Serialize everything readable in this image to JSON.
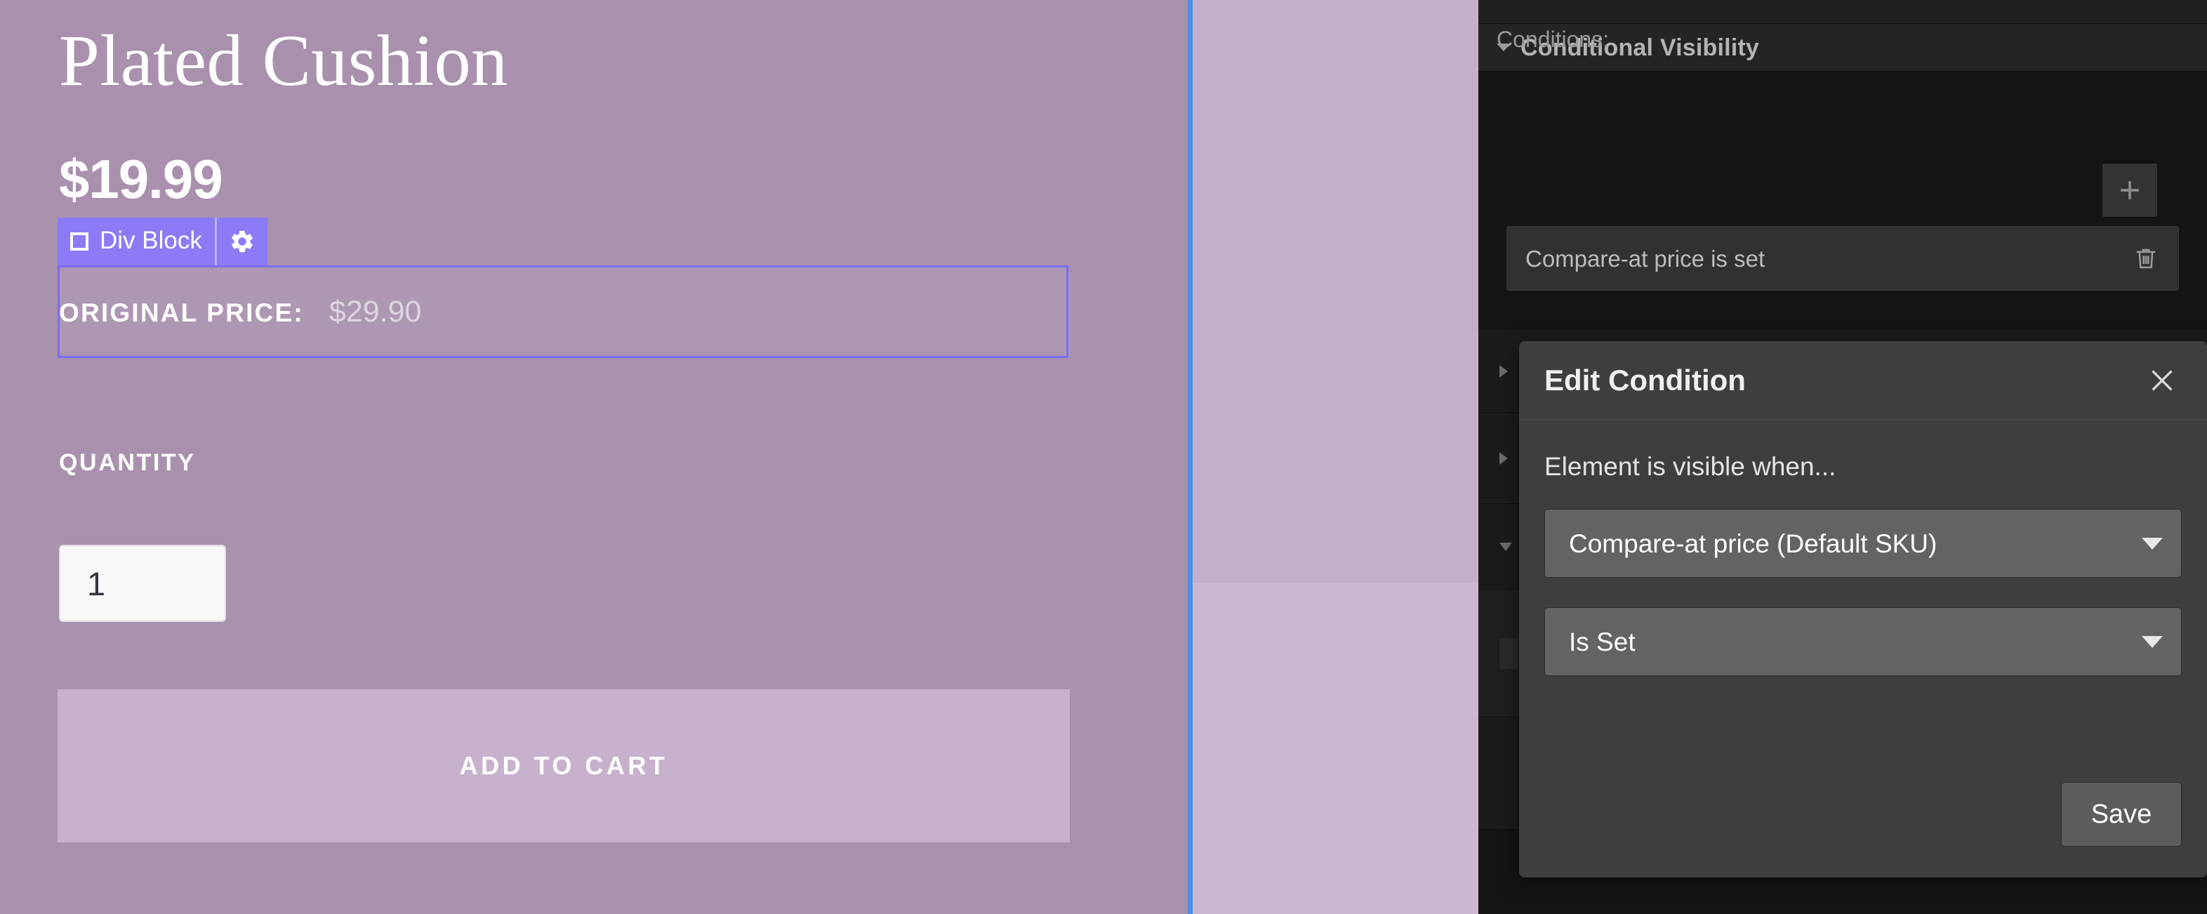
{
  "canvas": {
    "product_title": "Plated Cushion",
    "product_price": "$19.99",
    "original_price_label": "ORIGINAL PRICE:",
    "original_price_value": "$29.90",
    "quantity_label": "QUANTITY",
    "quantity_value": "1",
    "add_to_cart_label": "ADD TO CART",
    "background_color": "#a991ae",
    "column_color": "#c4afca",
    "guide_color": "#4a90e8"
  },
  "selection": {
    "badge_label": "Div Block",
    "badge_color": "#8b7bf7",
    "outline_color": "#7c6df2",
    "square_icon": "square-icon",
    "gear_icon": "gear-icon"
  },
  "panel": {
    "section_title": "Conditional Visibility",
    "collapse_icon": "chevron-down-icon",
    "conditions_label": "Conditions:",
    "add_icon": "plus-icon",
    "conditions": [
      {
        "text": "Compare-at price is set",
        "delete_icon": "trash-icon"
      }
    ]
  },
  "dialog": {
    "title": "Edit Condition",
    "close_icon": "close-icon",
    "subtitle": "Element is visible when...",
    "field_select": {
      "value": "Compare-at price (Default SKU)",
      "caret_icon": "chevron-down-icon"
    },
    "operator_select": {
      "value": "Is Set",
      "caret_icon": "chevron-down-icon"
    },
    "save_label": "Save"
  }
}
